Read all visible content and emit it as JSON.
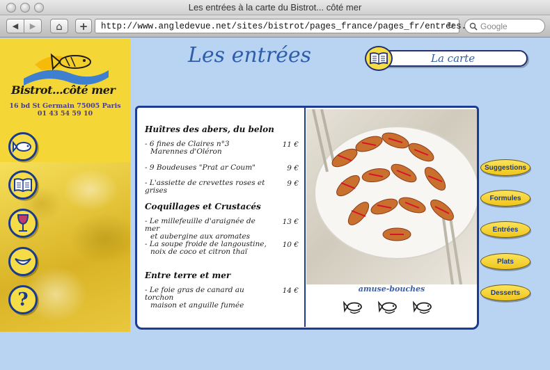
{
  "window": {
    "title": "Les entrées à la carte du Bistrot... côté mer"
  },
  "toolbar": {
    "back_label": "◀",
    "forward_label": "▶",
    "home_label": "⌂",
    "add_label": "+",
    "url": "http://www.angledevue.net/sites/bistrot/pages_france/pages_fr/entrees.html",
    "search_placeholder": "Google"
  },
  "sidebar": {
    "brand": "Bistrot...côté mer",
    "address_line1": "16 bd St Germain 75005 Paris",
    "address_line2": "01 43 54 59 10",
    "icons": [
      "fish-icon",
      "book-icon",
      "wine-glass-icon",
      "smile-icon",
      "question-icon"
    ]
  },
  "page": {
    "title": "Les entrées",
    "carte_label": "La carte"
  },
  "menu": {
    "sections": [
      {
        "title": "Huîtres des abers, du belon",
        "dishes": [
          {
            "line1": "- 6 fines de Claires n°3",
            "line2": "Marennes d'Oléron",
            "price": "11 €"
          },
          {
            "line1": "- 9 Boudeuses \"Prat ar Coum\"",
            "line2": "",
            "price": "9 €"
          },
          {
            "line1": "- L'assiette de crevettes roses et grises",
            "line2": "",
            "price": "9 €"
          }
        ]
      },
      {
        "title": "Coquillages et Crustacés",
        "dishes": [
          {
            "line1": "- Le millefeuille d'araignée de mer",
            "line2": "et aubergine aux aromates",
            "price": "13 €"
          },
          {
            "line1": "- La soupe froide de langoustine,",
            "line2": "noix de coco et citron thaï",
            "price": "10 €"
          }
        ]
      },
      {
        "title": "Entre terre et mer",
        "dishes": [
          {
            "line1": "- Le foie gras de canard au torchon",
            "line2": "maison et anguille fumée",
            "price": "14 €"
          }
        ]
      }
    ],
    "photo_caption": "amuse-bouches"
  },
  "nav": {
    "suggestions": "Suggestions",
    "formules": "Formules",
    "entrees": "Entrées",
    "plats": "Plats",
    "desserts": "Desserts"
  },
  "colors": {
    "sidebar": "#f4d736",
    "page_background": "#b9d3f3",
    "accent_blue": "#1b3c8f",
    "title_blue": "#2f5ea8"
  }
}
